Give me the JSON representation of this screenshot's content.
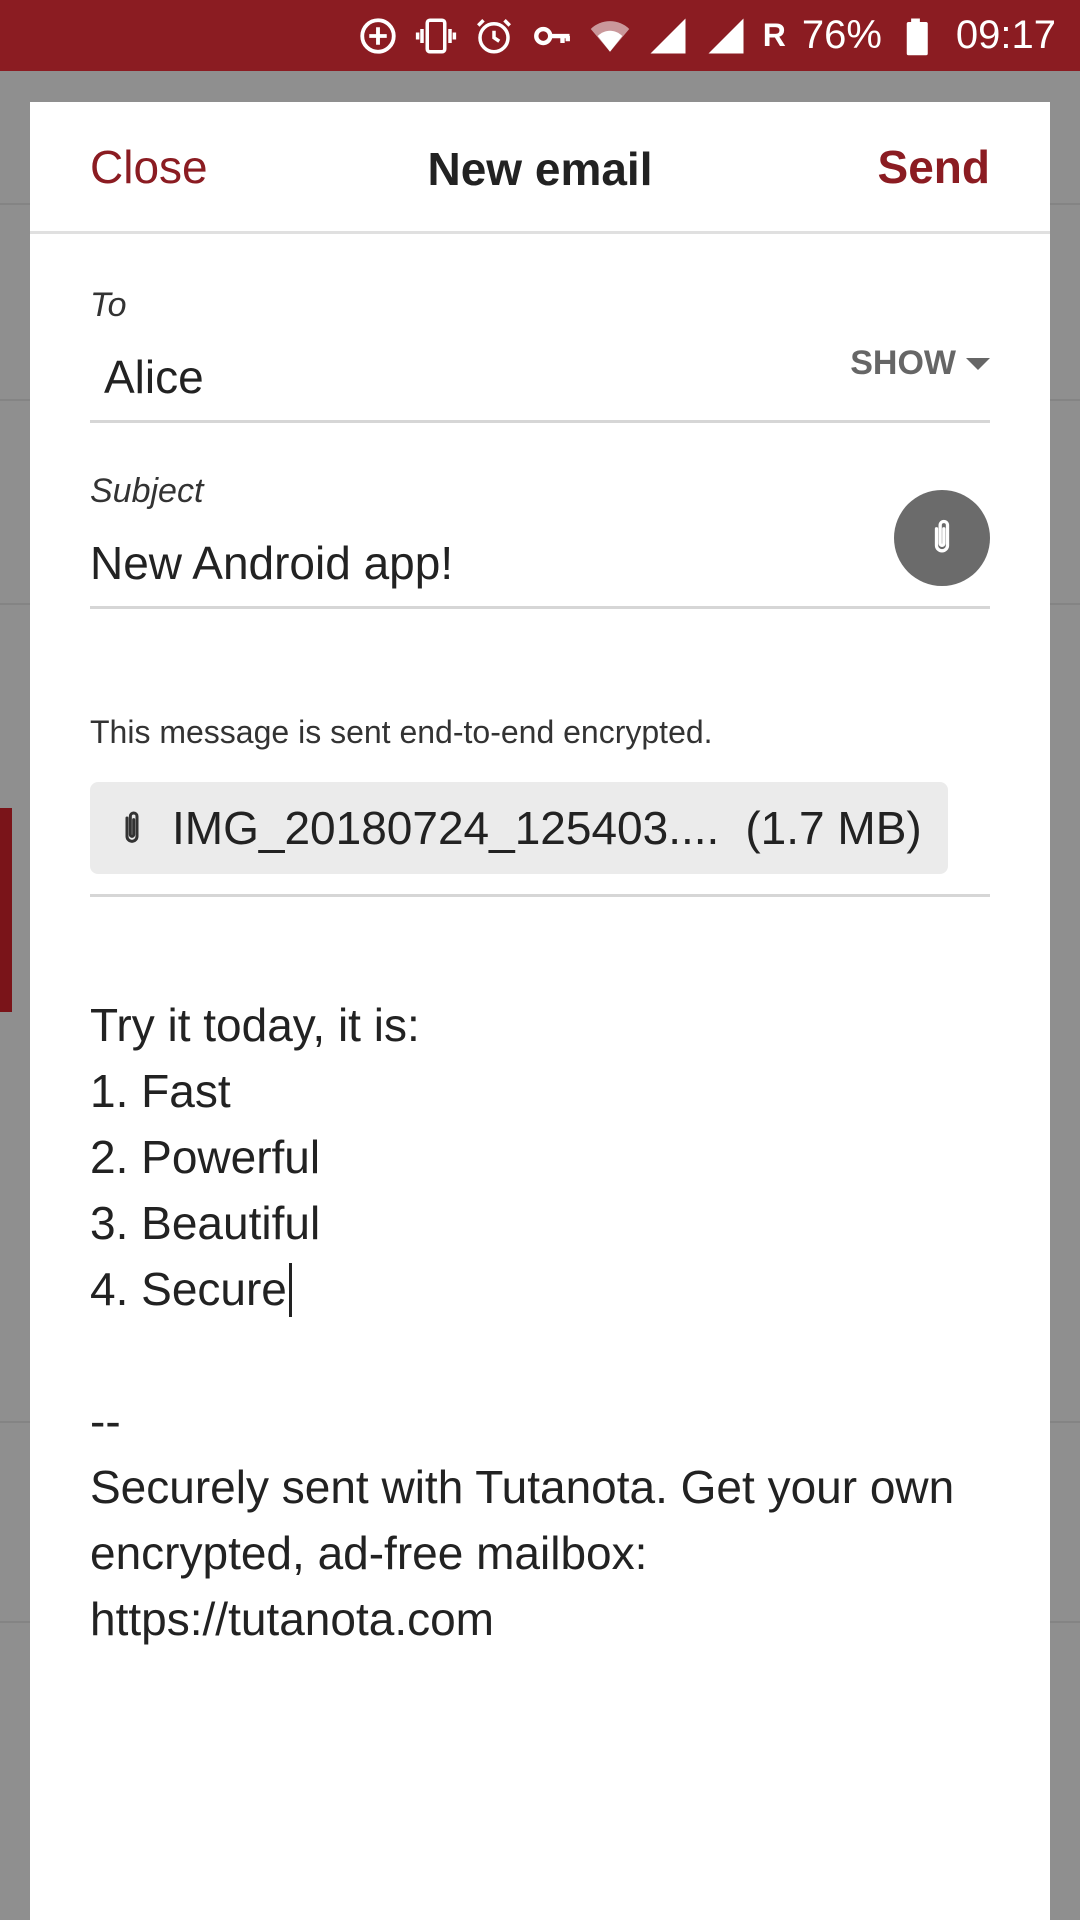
{
  "status_bar": {
    "icons": [
      "add-circle-icon",
      "vibrate-icon",
      "alarm-icon",
      "vpn-key-icon",
      "wifi-icon",
      "signal-icon",
      "signal-icon"
    ],
    "roaming": "R",
    "battery": "76%",
    "time": "09:17"
  },
  "header": {
    "close_label": "Close",
    "title": "New email",
    "send_label": "Send"
  },
  "to": {
    "label": "To",
    "value": "Alice",
    "show_label": "SHOW"
  },
  "subject": {
    "label": "Subject",
    "value": "New Android app!"
  },
  "encryption_note": "This message is sent end-to-end encrypted.",
  "attachment": {
    "name": "IMG_20180724_125403....",
    "size": "(1.7 MB)"
  },
  "body": {
    "lines": [
      "Try it today, it is:",
      "1. Fast",
      "2. Powerful",
      "3. Beautiful",
      "4. Secure",
      "",
      "--",
      "Securely sent with Tutanota. Get your own",
      "encrypted, ad-free mailbox:",
      "https://tutanota.com"
    ]
  },
  "colors": {
    "accent": "#8b1c22",
    "status_bar": "#8b1c22",
    "fab": "#6b6b6b"
  }
}
